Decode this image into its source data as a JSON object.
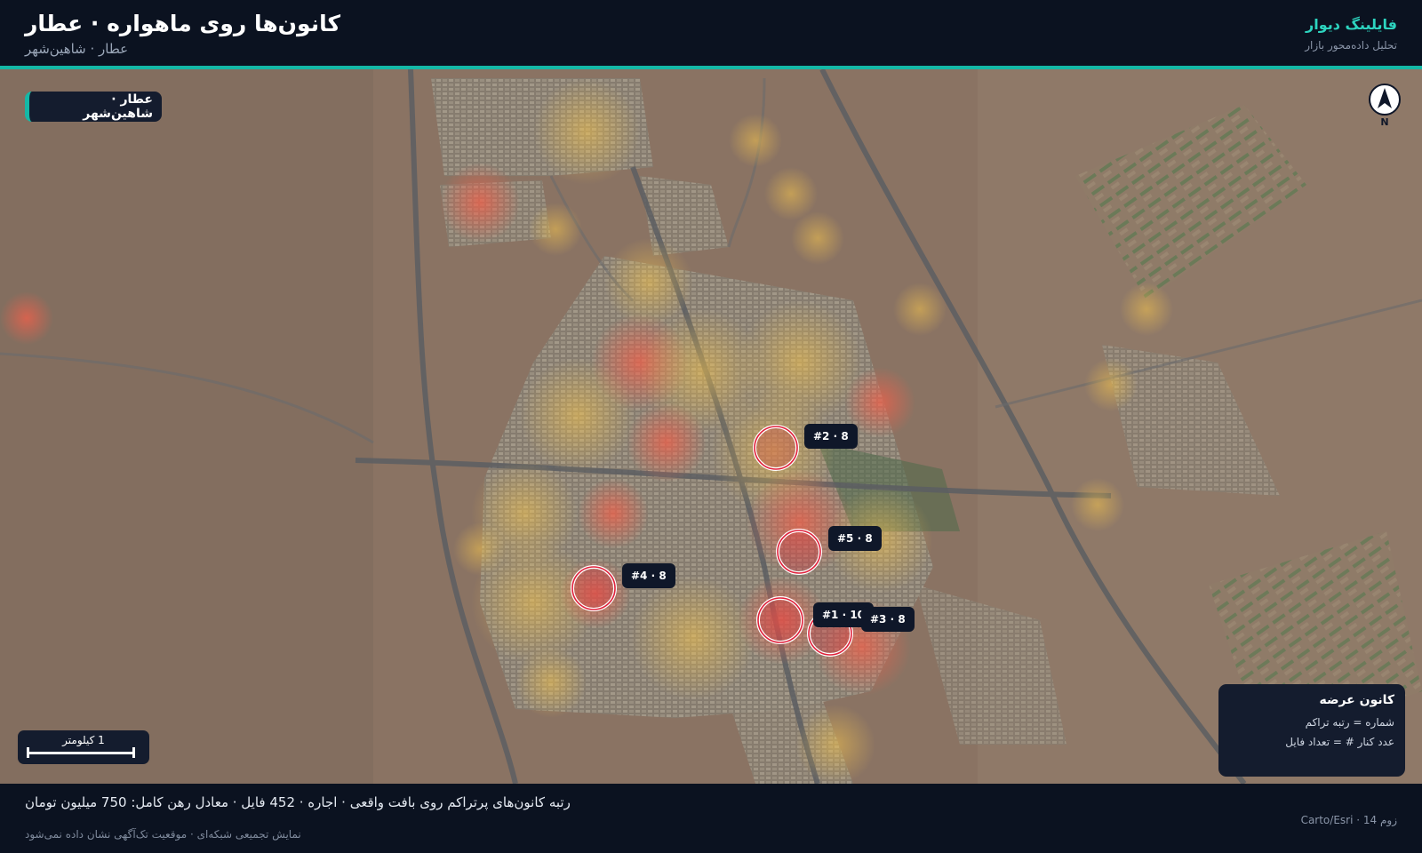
{
  "header": {
    "title": "کانون‌ها روی ماهواره · عطار",
    "subtitle": "عطار · شاهین‌شهر",
    "brand": "فایلینگ دیوار",
    "brand_sub": "تحلیل داده‌محور بازار"
  },
  "map": {
    "region_badge": "عطار · شاهین‌شهر",
    "compass_letter": "N",
    "scale_label": "1 کیلومتر",
    "colors": {
      "accent": "#14b8a6",
      "ring": "#e0203a",
      "heat_hot": "#f0604a",
      "heat_warm": "#f2c24e",
      "panel": "#141c2e"
    },
    "hotspots": [
      {
        "label": "#1 · 10",
        "rank": 1,
        "count": 10
      },
      {
        "label": "#2 · 8",
        "rank": 2,
        "count": 8
      },
      {
        "label": "#3 · 8",
        "rank": 3,
        "count": 8
      },
      {
        "label": "#4 · 8",
        "rank": 4,
        "count": 8
      },
      {
        "label": "#5 · 8",
        "rank": 5,
        "count": 8
      }
    ]
  },
  "legend": {
    "title": "کانون عرضه",
    "line1": "شماره = رتبه تراکم",
    "line2": "عدد کنار # = تعداد فایل"
  },
  "footer": {
    "main": "رتبه کانون‌های پرتراکم روی بافت واقعی · اجاره · 452 فایل · معادل رهن کامل: 750 میلیون تومان",
    "note": "نمایش تجمیعی شبکه‌ای · موقعیت تک‌آگهی نشان داده نمی‌شود",
    "right": "Carto/Esri · زوم 14"
  }
}
